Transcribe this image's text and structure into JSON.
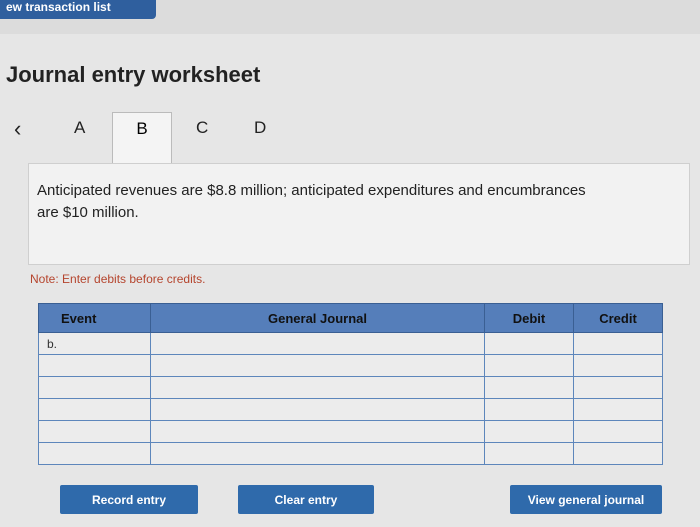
{
  "top_button": {
    "label": "ew transaction list"
  },
  "page": {
    "title": "Journal entry worksheet"
  },
  "tabs": {
    "prev_icon": "‹",
    "items": [
      "A",
      "B",
      "C",
      "D"
    ],
    "active": "B"
  },
  "problem": {
    "text": "Anticipated revenues are $8.8 million; anticipated expenditures and encumbrances are $10 million."
  },
  "note": "Note: Enter debits before credits.",
  "journal": {
    "columns": {
      "event": "Event",
      "general_journal": "General Journal",
      "debit": "Debit",
      "credit": "Credit"
    },
    "rows": [
      {
        "event": "b.",
        "general_journal": "",
        "debit": "",
        "credit": ""
      },
      {
        "event": "",
        "general_journal": "",
        "debit": "",
        "credit": ""
      },
      {
        "event": "",
        "general_journal": "",
        "debit": "",
        "credit": ""
      },
      {
        "event": "",
        "general_journal": "",
        "debit": "",
        "credit": ""
      },
      {
        "event": "",
        "general_journal": "",
        "debit": "",
        "credit": ""
      },
      {
        "event": "",
        "general_journal": "",
        "debit": "",
        "credit": ""
      }
    ]
  },
  "buttons": {
    "record": "Record entry",
    "clear": "Clear entry",
    "view": "View general journal"
  },
  "colors": {
    "accent": "#2f6aab",
    "header": "#557eba",
    "note": "#b5452e"
  }
}
